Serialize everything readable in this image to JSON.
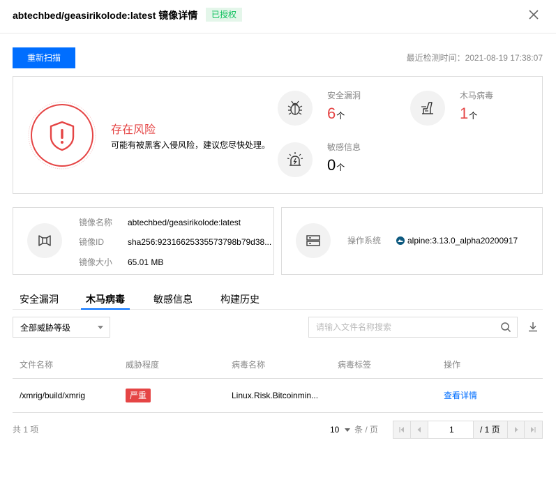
{
  "header": {
    "title": "abtechbed/geasirikolode:latest 镜像详情",
    "badge": "已授权"
  },
  "toolbar": {
    "rescan_label": "重新扫描",
    "last_check": "最近检测时间：2021-08-19 17:38:07"
  },
  "risk": {
    "title": "存在风险",
    "description": "可能有被黑客入侵风险，建议您尽快处理。",
    "stats": [
      {
        "label": "安全漏洞",
        "value": "6",
        "unit": "个",
        "icon": "bug-icon",
        "color": "#e54545"
      },
      {
        "label": "木马病毒",
        "value": "1",
        "unit": "个",
        "icon": "trojan-icon",
        "color": "#e54545"
      },
      {
        "label": "敏感信息",
        "value": "0",
        "unit": "个",
        "icon": "alarm-icon",
        "color": "#000000"
      }
    ]
  },
  "image_info": {
    "name_label": "镜像名称",
    "name_value": "abtechbed/geasirikolode:latest",
    "id_label": "镜像ID",
    "id_value": "sha256:92316625335573798b79d38...",
    "size_label": "镜像大小",
    "size_value": "65.01 MB"
  },
  "os_info": {
    "label": "操作系统",
    "value": "alpine:3.13.0_alpha20200917"
  },
  "tabs": [
    {
      "label": "安全漏洞",
      "active": false
    },
    {
      "label": "木马病毒",
      "active": true
    },
    {
      "label": "敏感信息",
      "active": false
    },
    {
      "label": "构建历史",
      "active": false
    }
  ],
  "filter": {
    "threat_level": "全部威胁等级",
    "search_placeholder": "请输入文件名称搜索"
  },
  "table": {
    "columns": [
      "文件名称",
      "威胁程度",
      "病毒名称",
      "病毒标签",
      "操作"
    ],
    "rows": [
      {
        "file": "/xmrig/build/xmrig",
        "threat": "严重",
        "virus": "Linux.Risk.Bitcoinmin...",
        "tag": "",
        "action": "查看详情"
      }
    ]
  },
  "pagination": {
    "total": "共 1 项",
    "page_size": "10",
    "page_size_unit": "条 / 页",
    "current_page": "1",
    "total_pages": "/ 1 页"
  },
  "colors": {
    "primary": "#006eff",
    "danger": "#e54545",
    "success": "#0abf5b"
  }
}
